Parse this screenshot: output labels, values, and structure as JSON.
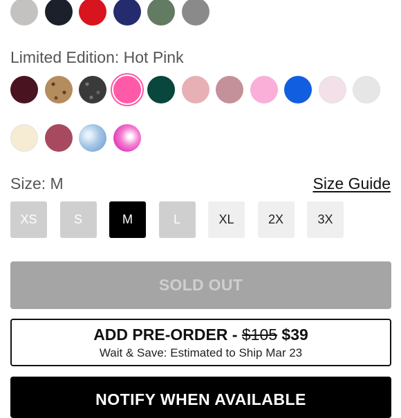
{
  "top_colors": [
    {
      "name": "swatch-light-gray",
      "color": "#c4c2c0"
    },
    {
      "name": "swatch-navy-black",
      "color": "#1c202b"
    },
    {
      "name": "swatch-red",
      "color": "#d8141f"
    },
    {
      "name": "swatch-royal-navy",
      "color": "#252c6e"
    },
    {
      "name": "swatch-sage-green",
      "color": "#637a63"
    },
    {
      "name": "swatch-gray",
      "color": "#8a8a8a"
    }
  ],
  "color_label": "Limited Edition: Hot Pink",
  "colors_row1": [
    {
      "name": "swatch-burgundy",
      "color": "#4a1320"
    },
    {
      "name": "swatch-leopard",
      "color": "#b48c5e",
      "pattern": "leopard"
    },
    {
      "name": "swatch-dark-leopard",
      "color": "#3a3a3a",
      "pattern": "dark-leopard"
    },
    {
      "name": "swatch-hot-pink",
      "color": "#ff5aa8",
      "selected": true
    },
    {
      "name": "swatch-dark-teal",
      "color": "#09463d"
    },
    {
      "name": "swatch-blush",
      "color": "#e7b0b4"
    },
    {
      "name": "swatch-mauve",
      "color": "#c49099"
    },
    {
      "name": "swatch-light-pink",
      "color": "#f9afd8"
    },
    {
      "name": "swatch-royal-blue",
      "color": "#115fe0"
    },
    {
      "name": "swatch-pale-pink",
      "color": "#f3e0e8"
    },
    {
      "name": "swatch-heather-white",
      "color": "#e6e6e6"
    }
  ],
  "colors_row2": [
    {
      "name": "swatch-cream",
      "color": "#f6ecd4"
    },
    {
      "name": "swatch-raspberry",
      "color": "#a74a5f"
    },
    {
      "name": "swatch-sky-tie-dye",
      "color": "#a6c6e6",
      "pattern": "tie-dye-blue"
    },
    {
      "name": "swatch-pink-tie-dye",
      "color": "#f57fd2",
      "pattern": "tie-dye-pink"
    }
  ],
  "size_label": "Size: M",
  "size_guide": "Size Guide",
  "sizes": [
    {
      "label": "XS",
      "state": "unavailable"
    },
    {
      "label": "S",
      "state": "unavailable"
    },
    {
      "label": "M",
      "state": "selected"
    },
    {
      "label": "L",
      "state": "unavailable"
    },
    {
      "label": "XL",
      "state": "available"
    },
    {
      "label": "2X",
      "state": "available"
    },
    {
      "label": "3X",
      "state": "available"
    }
  ],
  "sold_out_label": "SOLD OUT",
  "preorder": {
    "prefix": "ADD PRE-ORDER - ",
    "old_price": "$105",
    "new_price": "$39",
    "subtitle": "Wait & Save: Estimated to Ship Mar 23"
  },
  "notify_label": "NOTIFY WHEN AVAILABLE"
}
